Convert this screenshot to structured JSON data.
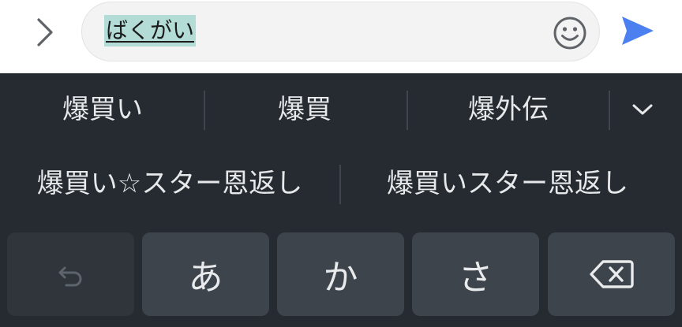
{
  "compose": {
    "text": "ばくがい"
  },
  "icons": {
    "expand": "chevron-right-icon",
    "emoji": "smiley-icon",
    "send": "send-icon",
    "more_candidates": "chevron-down-icon",
    "undo": "undo-icon",
    "backspace": "backspace-icon"
  },
  "candidates": {
    "row1": [
      "爆買い",
      "爆買",
      "爆外伝"
    ],
    "row2": [
      "爆買い☆スター恩返し",
      "爆買いスター恩返し"
    ]
  },
  "keys": {
    "a": "あ",
    "ka": "か",
    "sa": "さ"
  },
  "colors": {
    "send_accent": "#4c7ff0",
    "keyboard_bg": "#252b31",
    "key_bg": "#3e444b",
    "composition_highlight": "#b3dcd7"
  }
}
